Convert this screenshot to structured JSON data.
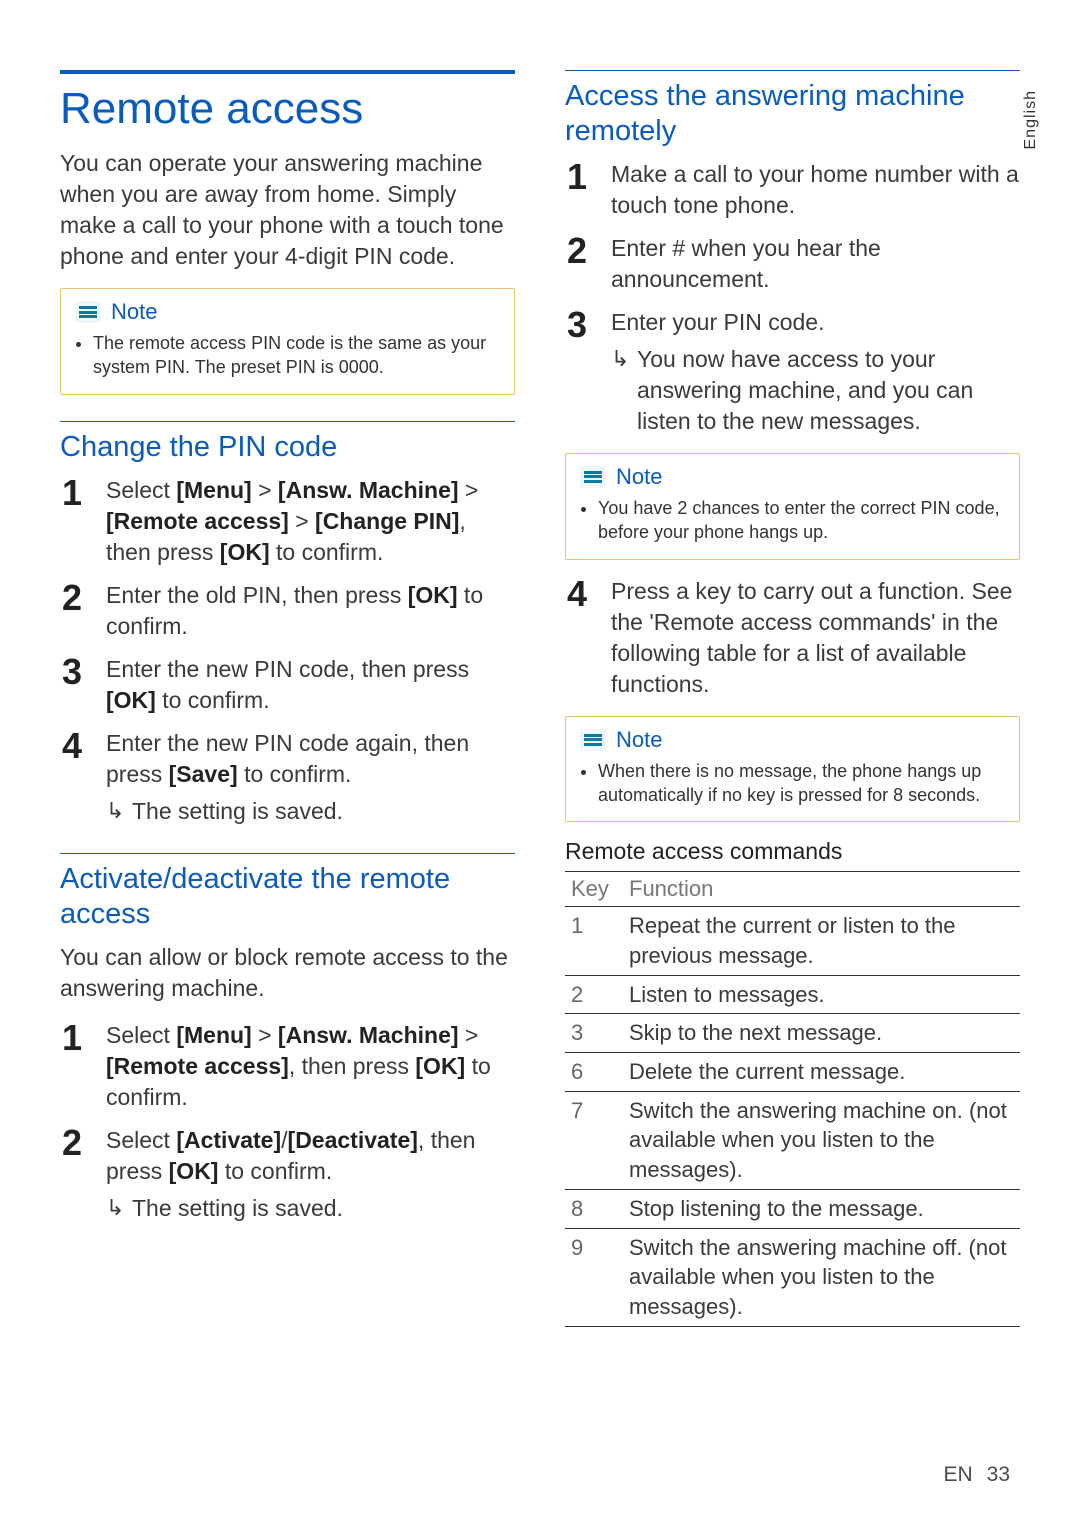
{
  "lang_tab": "English",
  "left": {
    "section_title": "Remote access",
    "intro": "You can operate your answering machine when you are away from home. Simply make a call to your phone with a touch tone phone and enter your 4-digit PIN code.",
    "note1_label": "Note",
    "note1_item": "The remote access PIN code is the same as your system PIN. The preset PIN is 0000.",
    "sub1": "Change the PIN code",
    "s1_1a": "Select ",
    "s1_1b": "[Menu]",
    "s1_1c": " > ",
    "s1_1d": "[Answ. Machine]",
    "s1_1e": " > ",
    "s1_1f": "[Remote access]",
    "s1_1g": " > ",
    "s1_1h": "[Change PIN]",
    "s1_1i": ", then press ",
    "s1_1j": "[OK]",
    "s1_1k": " to confirm.",
    "s1_2a": "Enter the old PIN, then press ",
    "s1_2b": "[OK]",
    "s1_2c": " to confirm.",
    "s1_3a": "Enter the new PIN code, then press ",
    "s1_3b": "[OK]",
    "s1_3c": " to confirm.",
    "s1_4a": "Enter the new PIN code again, then press ",
    "s1_4b": "[Save]",
    "s1_4c": " to confirm.",
    "s1_4r": "The setting is saved.",
    "sub2": "Activate/deactivate the remote access",
    "sub2_intro": "You can allow or block remote access to the answering machine.",
    "s2_1a": "Select ",
    "s2_1b": "[Menu]",
    "s2_1c": " > ",
    "s2_1d": "[Answ. Machine]",
    "s2_1e": " > ",
    "s2_1f": "[Remote access]",
    "s2_1g": ", then press ",
    "s2_1h": "[OK]",
    "s2_1i": " to confirm.",
    "s2_2a": "Select ",
    "s2_2b": "[Activate]",
    "s2_2c": "/",
    "s2_2d": "[Deactivate]",
    "s2_2e": ", then press ",
    "s2_2f": "[OK]",
    "s2_2g": " to confirm.",
    "s2_2r": "The setting is saved."
  },
  "right": {
    "sub1": "Access the answering machine remotely",
    "r1_1": "Make a call to your home number with a touch tone phone.",
    "r1_2": "Enter # when you hear the announcement.",
    "r1_3": "Enter your PIN code.",
    "r1_3r": "You now have access to your answering machine, and you can listen to the new messages.",
    "note2_label": "Note",
    "note2_item": "You have 2 chances to enter the correct PIN code, before your phone hangs up.",
    "r1_4": "Press a key to carry out a function. See the 'Remote access commands' in the following table for a list of available functions.",
    "note3_label": "Note",
    "note3_item": "When there is no message, the phone hangs up automatically if no key is pressed for 8 seconds.",
    "table_title": "Remote access commands",
    "th_key": "Key",
    "th_func": "Function",
    "rows": [
      {
        "key": "1",
        "func": "Repeat the current or listen to the previous message."
      },
      {
        "key": "2",
        "func": "Listen to messages."
      },
      {
        "key": "3",
        "func": "Skip to the next message."
      },
      {
        "key": "6",
        "func": "Delete the current message."
      },
      {
        "key": "7",
        "func": "Switch the answering machine on. (not available when you listen to the messages)."
      },
      {
        "key": "8",
        "func": "Stop listening to the message."
      },
      {
        "key": "9",
        "func": "Switch the answering machine off. (not available when you listen to the messages)."
      }
    ]
  },
  "footer_lang": "EN",
  "footer_page": "33"
}
